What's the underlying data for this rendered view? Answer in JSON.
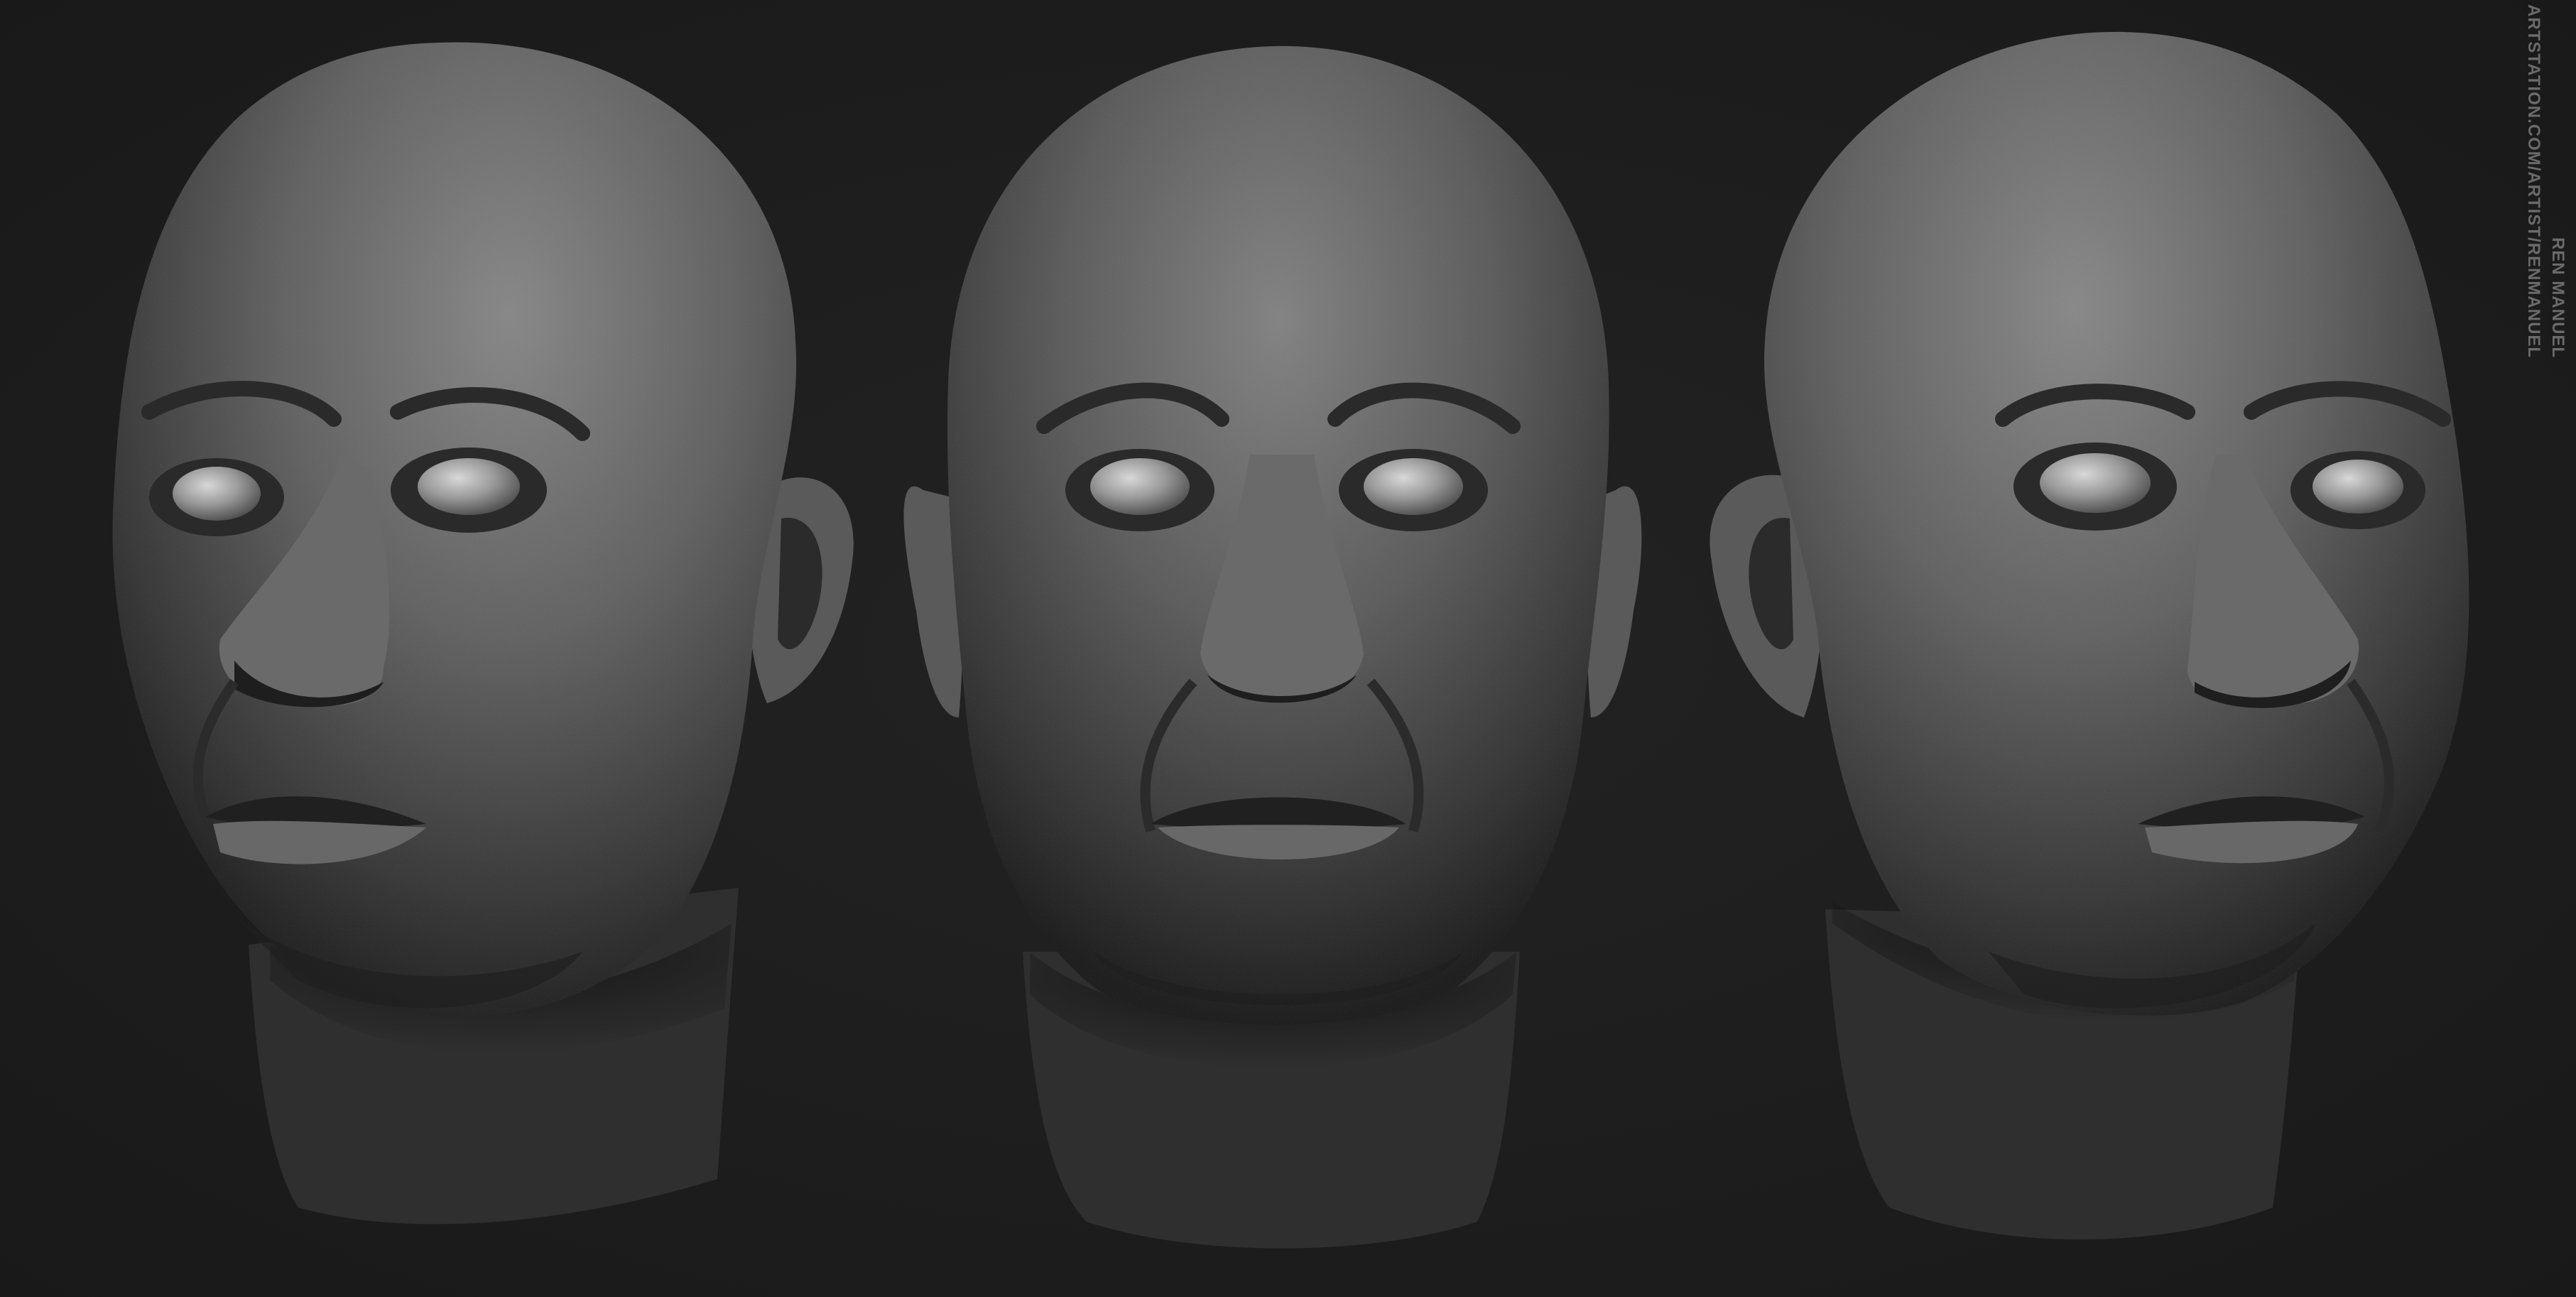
{
  "credit": {
    "name": "REN MANUEL",
    "url": "ARTSTATION.COM/ARTIST/RENMANUEL"
  },
  "views": [
    {
      "id": "head-three-quarter-left"
    },
    {
      "id": "head-front"
    },
    {
      "id": "head-three-quarter-right"
    }
  ],
  "colors": {
    "background": "#1c1c1c",
    "skin_light": "#7a7a7a",
    "skin_mid": "#4a4a4a",
    "skin_dark": "#151515",
    "eye": "#9a9a9a",
    "credit_text": "#6a6a6a"
  }
}
